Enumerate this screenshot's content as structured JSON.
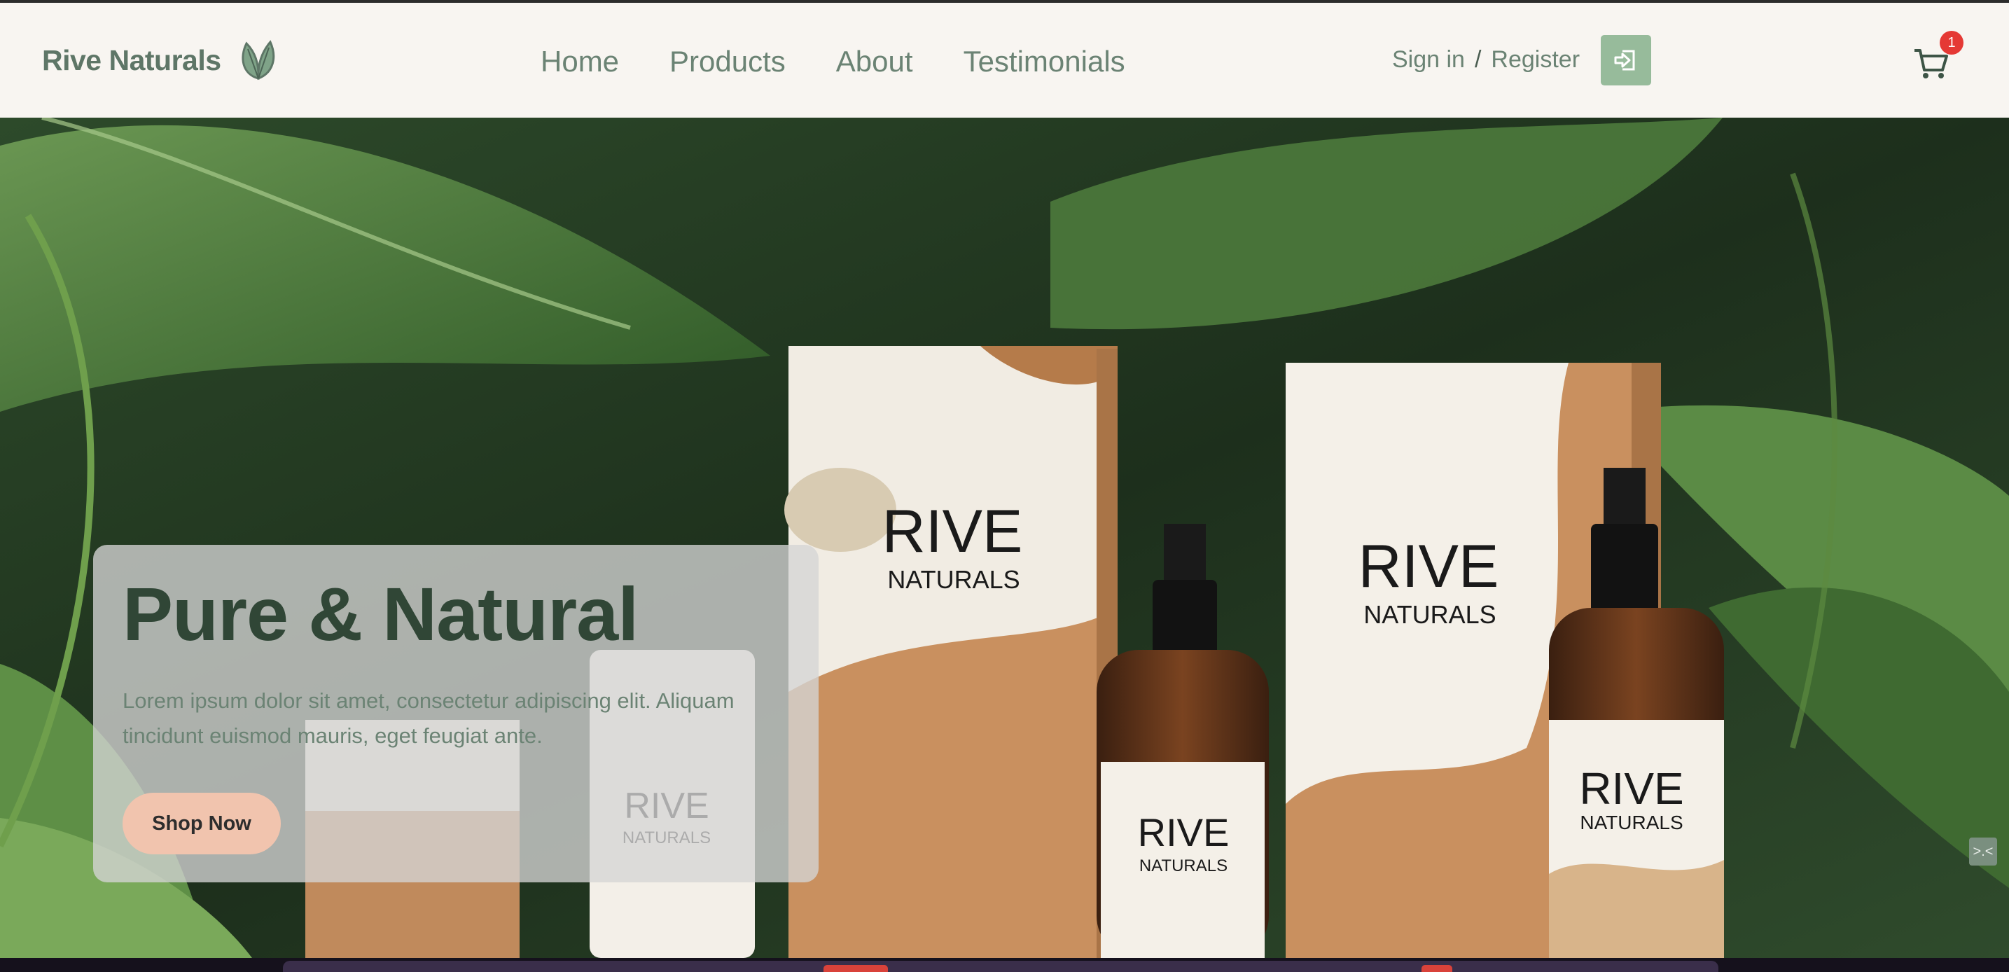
{
  "header": {
    "brand": "Rive Naturals",
    "brand_icon": "leaf-icon",
    "nav": [
      "Home",
      "Products",
      "About",
      "Testimonials"
    ],
    "signin": "Sign in",
    "separator": "/",
    "register": "Register",
    "logout_icon": "sign-out-icon",
    "cart_icon": "shopping-cart-icon",
    "cart_count": "1"
  },
  "hero": {
    "title": "Pure & Natural",
    "text": "Lorem ipsum dolor sit amet, consectetur adipiscing elit. Aliquam tincidunt euismod mauris, eget feugiat ante.",
    "cta": "Shop Now",
    "image_alt": "Rive Naturals product boxes and spray bottles among green leaves",
    "product_text": [
      "RIVE",
      "NATURALS"
    ],
    "handle_icon": "collapse-arrows-icon",
    "handle_label": ">.<"
  },
  "colors": {
    "header_bg": "#f8f5f1",
    "brand_green": "#5e7667",
    "accent_green": "#97bb9b",
    "cta_peach": "#f1c4ae",
    "title_dark": "#304636",
    "badge_red": "#e53935"
  }
}
